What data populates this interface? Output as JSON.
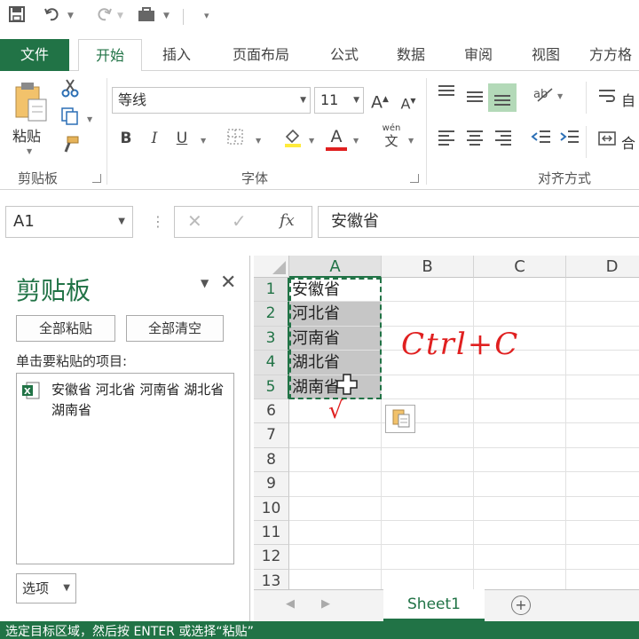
{
  "quick_access": {
    "save_icon": "save-icon",
    "undo_icon": "undo-icon",
    "redo_icon": "redo-icon",
    "touch_mode_icon": "briefcase-icon",
    "customize_icon": "customize-icon"
  },
  "tabs": [
    {
      "label": "文件"
    },
    {
      "label": "开始"
    },
    {
      "label": "插入"
    },
    {
      "label": "页面布局"
    },
    {
      "label": "公式"
    },
    {
      "label": "数据"
    },
    {
      "label": "审阅"
    },
    {
      "label": "视图"
    },
    {
      "label": "方方格"
    }
  ],
  "ribbon": {
    "clipboard": {
      "paste_label": "粘贴",
      "group_label": "剪贴板"
    },
    "font": {
      "font_name": "等线",
      "font_size": "11",
      "bold": "B",
      "italic": "I",
      "underline": "U",
      "phonetic": "wén",
      "phonetic_char": "文",
      "font_color": "#e02020",
      "group_label": "字体"
    },
    "alignment": {
      "group_label": "对齐方式",
      "wrap_label": "自",
      "merge_label": "合"
    }
  },
  "formula_bar": {
    "name_box": "A1",
    "fx_label": "fx",
    "formula": "安徽省"
  },
  "clipboard_pane": {
    "title": "剪贴板",
    "paste_all": "全部粘贴",
    "clear_all": "全部清空",
    "hint": "单击要粘贴的项目:",
    "items": [
      {
        "text": "安徽省 河北省 河南省 湖北省 湖南省"
      }
    ],
    "options": "选项"
  },
  "sheet": {
    "columns": [
      "A",
      "B",
      "C",
      "D"
    ],
    "rows": [
      "1",
      "2",
      "3",
      "4",
      "5",
      "6",
      "7",
      "8",
      "9",
      "10",
      "11",
      "12",
      "13"
    ],
    "column_a_values": [
      "安徽省",
      "河北省",
      "河南省",
      "湖北省",
      "湖南省"
    ],
    "tab": "Sheet1"
  },
  "annotations": {
    "shortcut": "Ctrl+C",
    "check": "√"
  },
  "status": {
    "text": "选定目标区域，然后按 ENTER 或选择“粘贴”"
  },
  "colors": {
    "accent": "#217346",
    "annotation": "#e02020"
  }
}
